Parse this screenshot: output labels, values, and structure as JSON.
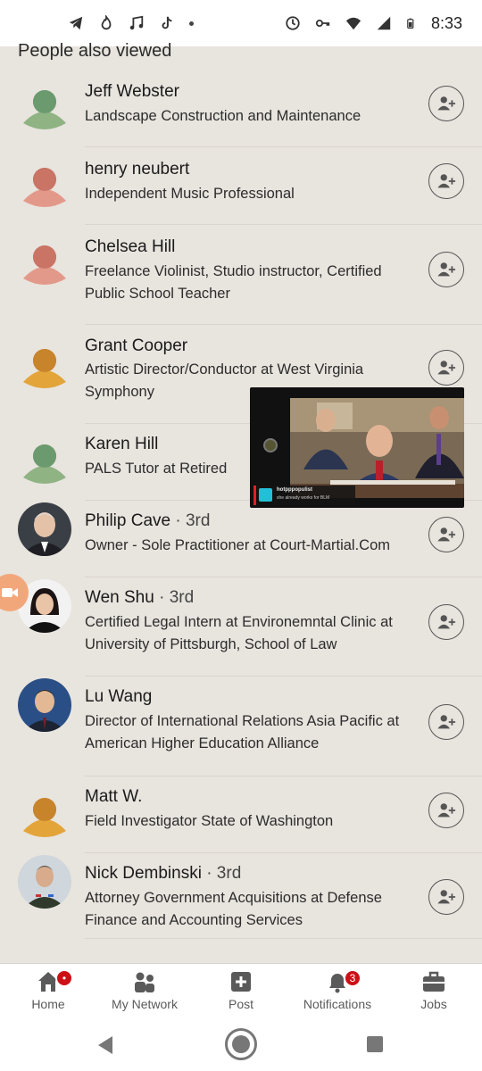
{
  "status_bar": {
    "time": "8:33",
    "left_icons": [
      "telegram-icon",
      "flame-icon",
      "music-icon",
      "tiktok-icon",
      "dot-icon"
    ],
    "right_icons": [
      "sync-icon",
      "vpn-key-icon",
      "wifi-icon",
      "signal-icon",
      "battery-icon"
    ]
  },
  "section": {
    "heading": "People also viewed"
  },
  "people": [
    {
      "name": "Jeff Webster",
      "degree": "",
      "headline": "Landscape Construction and Maintenance",
      "avatar": "placeholder-green"
    },
    {
      "name": "henry neubert",
      "degree": "",
      "headline": "Independent Music Professional",
      "avatar": "placeholder-salmon"
    },
    {
      "name": "Chelsea Hill",
      "degree": "",
      "headline": "Freelance Violinist, Studio instructor, Certified Public School Teacher",
      "avatar": "placeholder-salmon"
    },
    {
      "name": "Grant Cooper",
      "degree": "",
      "headline": "Artistic Director/Conductor at West Virginia Symphony",
      "avatar": "placeholder-amber"
    },
    {
      "name": "Karen Hill",
      "degree": "",
      "headline": "PALS Tutor at Retired",
      "avatar": "placeholder-green"
    },
    {
      "name": "Philip Cave",
      "degree": " · 3rd",
      "headline": "Owner - Sole Practitioner at Court-Martial.Com",
      "avatar": "photo-philip"
    },
    {
      "name": "Wen Shu",
      "degree": " · 3rd",
      "headline": "Certified Legal Intern at Environemntal Clinic at University of Pittsburgh, School of Law",
      "avatar": "photo-wen"
    },
    {
      "name": "Lu Wang",
      "degree": "",
      "headline": "Director of International Relations Asia Pacific at American Higher Education Alliance",
      "avatar": "photo-lu"
    },
    {
      "name": "Matt W.",
      "degree": "",
      "headline": "Field Investigator State of Washington",
      "avatar": "placeholder-amber"
    },
    {
      "name": "Nick Dembinski",
      "degree": " · 3rd",
      "headline": "Attorney Government Acquisitions at Defense Finance and Accounting Services",
      "avatar": "photo-nick"
    }
  ],
  "pip_video": {
    "chat_user": "hotpppopulist",
    "chat_message": "she already works for BLM"
  },
  "bottom_nav": [
    {
      "label": "Home",
      "icon": "home-icon",
      "badge": "•"
    },
    {
      "label": "My Network",
      "icon": "network-icon",
      "badge": ""
    },
    {
      "label": "Post",
      "icon": "post-icon",
      "badge": ""
    },
    {
      "label": "Notifications",
      "icon": "bell-icon",
      "badge": "3"
    },
    {
      "label": "Jobs",
      "icon": "briefcase-icon",
      "badge": ""
    }
  ],
  "colors": {
    "background": "#e8e4de",
    "badge": "#cc1016",
    "placeholder_green": "#8fb383",
    "placeholder_salmon": "#e3998a",
    "placeholder_amber": "#e3a43a"
  }
}
